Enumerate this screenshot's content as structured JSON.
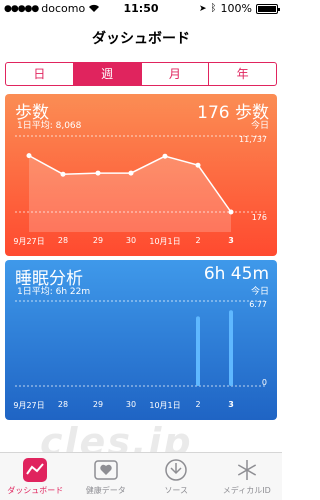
{
  "status": {
    "carrier": "docomo",
    "time": "11:50",
    "battery": "100%",
    "battery_level": 1.0
  },
  "header": {
    "title": "ダッシュボード"
  },
  "segments": [
    {
      "label": "日",
      "active": false
    },
    {
      "label": "週",
      "active": true
    },
    {
      "label": "月",
      "active": false
    },
    {
      "label": "年",
      "active": false
    }
  ],
  "steps_card": {
    "name": "歩数",
    "average": "1日平均: 8,068",
    "today_value": "176 歩数",
    "today_label": "今日",
    "y_max": "11,737",
    "y_min": "176",
    "x_labels": [
      "9月27日",
      "28",
      "29",
      "30",
      "10月1日",
      "2",
      "3"
    ]
  },
  "sleep_card": {
    "name": "睡眠分析",
    "average": "1日平均: 6h 22m",
    "today_value": "6h 45m",
    "today_label": "今日",
    "y_max": "6.77",
    "y_min": "0",
    "x_labels": [
      "9月27日",
      "28",
      "29",
      "30",
      "10月1日",
      "2",
      "3"
    ]
  },
  "chart_data": [
    {
      "type": "area",
      "title": "歩数",
      "categories": [
        "9月27日",
        "28",
        "29",
        "30",
        "10月1日",
        "2",
        "3"
      ],
      "values": [
        10200,
        6900,
        7100,
        7100,
        10100,
        8500,
        176
      ],
      "ylim": [
        176,
        11737
      ]
    },
    {
      "type": "bar",
      "title": "睡眠分析",
      "categories": [
        "9月27日",
        "28",
        "29",
        "30",
        "10月1日",
        "2",
        "3"
      ],
      "values": [
        null,
        null,
        null,
        null,
        null,
        6.2,
        6.75
      ],
      "ylim": [
        0,
        6.77
      ]
    }
  ],
  "watermark": "cles.jp",
  "tabs": [
    {
      "label": "ダッシュボード",
      "icon": "dashboard-icon",
      "active": true
    },
    {
      "label": "健康データ",
      "icon": "health-data-icon",
      "active": false
    },
    {
      "label": "ソース",
      "icon": "sources-icon",
      "active": false
    },
    {
      "label": "メディカルID",
      "icon": "medical-id-icon",
      "active": false
    }
  ],
  "colors": {
    "accent": "#e0245e",
    "steps_top": "#fb8d54",
    "steps_bottom": "#ff4a2f",
    "sleep_top": "#3f99ea",
    "sleep_bottom": "#1f64c4"
  }
}
